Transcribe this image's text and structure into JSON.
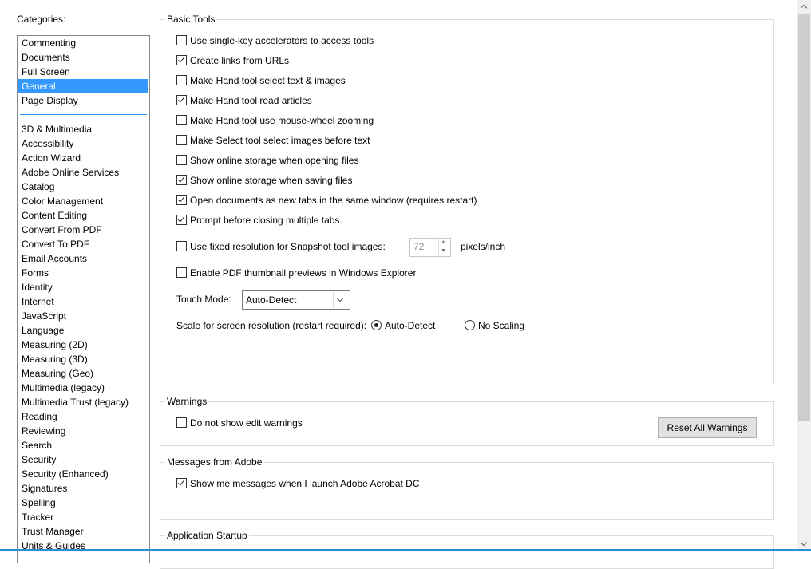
{
  "categories": {
    "title": "Categories:",
    "group1": [
      "Commenting",
      "Documents",
      "Full Screen",
      "General",
      "Page Display"
    ],
    "selected": "General",
    "group2": [
      "3D & Multimedia",
      "Accessibility",
      "Action Wizard",
      "Adobe Online Services",
      "Catalog",
      "Color Management",
      "Content Editing",
      "Convert From PDF",
      "Convert To PDF",
      "Email Accounts",
      "Forms",
      "Identity",
      "Internet",
      "JavaScript",
      "Language",
      "Measuring (2D)",
      "Measuring (3D)",
      "Measuring (Geo)",
      "Multimedia (legacy)",
      "Multimedia Trust (legacy)",
      "Reading",
      "Reviewing",
      "Search",
      "Security",
      "Security (Enhanced)",
      "Signatures",
      "Spelling",
      "Tracker",
      "Trust Manager",
      "Units & Guides"
    ]
  },
  "basic_tools": {
    "label": "Basic Tools",
    "options": [
      {
        "label": "Use single-key accelerators to access tools",
        "checked": false
      },
      {
        "label": "Create links from URLs",
        "checked": true
      },
      {
        "label": "Make Hand tool select text & images",
        "checked": false
      },
      {
        "label": "Make Hand tool read articles",
        "checked": true
      },
      {
        "label": "Make Hand tool use mouse-wheel zooming",
        "checked": false
      },
      {
        "label": "Make Select tool select images before text",
        "checked": false
      },
      {
        "label": "Show online storage when opening files",
        "checked": false
      },
      {
        "label": "Show online storage when saving files",
        "checked": true
      },
      {
        "label": "Open documents as new tabs in the same window (requires restart)",
        "checked": true
      },
      {
        "label": "Prompt before closing multiple tabs.",
        "checked": true
      }
    ],
    "snapshot": {
      "label": "Use fixed resolution for Snapshot tool images:",
      "checked": false,
      "value": "72",
      "unit": "pixels/inch"
    },
    "thumbnail": {
      "label": "Enable PDF thumbnail previews in Windows Explorer",
      "checked": false
    },
    "touch_mode": {
      "label": "Touch Mode:",
      "value": "Auto-Detect"
    },
    "scale": {
      "label": "Scale for screen resolution (restart required):",
      "option1": "Auto-Detect",
      "option2": "No Scaling",
      "selected": "Auto-Detect"
    }
  },
  "warnings": {
    "label": "Warnings",
    "option": {
      "label": "Do not show edit warnings",
      "checked": false
    },
    "reset_button": "Reset All Warnings"
  },
  "messages": {
    "label": "Messages from Adobe",
    "option": {
      "label": "Show me messages when I launch Adobe Acrobat DC",
      "checked": true
    }
  },
  "startup": {
    "label": "Application Startup"
  },
  "icons": [
    "checkbox-checked",
    "checkbox-unchecked",
    "radio-selected",
    "radio-unselected",
    "dropdown-chevron-icon",
    "spinner-up-icon",
    "spinner-down-icon",
    "scroll-up-icon",
    "scroll-down-icon"
  ]
}
